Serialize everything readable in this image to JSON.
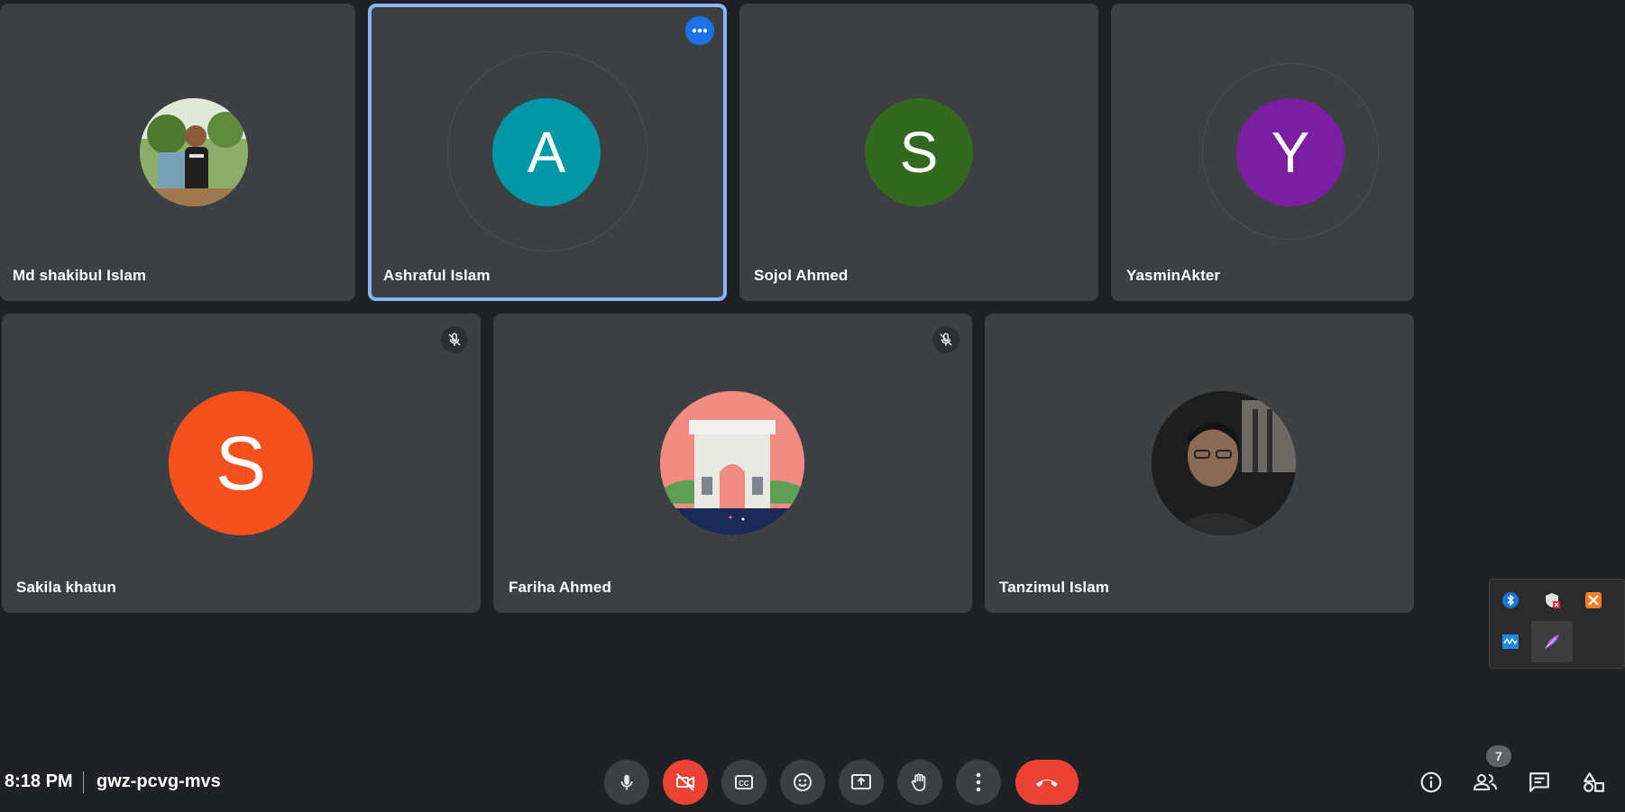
{
  "participants": [
    {
      "name": "Md shakibul Islam",
      "initial": "",
      "avatar_type": "photo",
      "color": "#6b8f4a"
    },
    {
      "name": "Ashraful Islam",
      "initial": "A",
      "avatar_type": "letter",
      "color": "#0097a7"
    },
    {
      "name": "Sojol Ahmed",
      "initial": "S",
      "avatar_type": "letter",
      "color": "#33691e"
    },
    {
      "name": "YasminAkter",
      "initial": "Y",
      "avatar_type": "letter",
      "color": "#7b1fa2"
    },
    {
      "name": "Sakila khatun",
      "initial": "S",
      "avatar_type": "letter",
      "color": "#f4511e",
      "muted": true
    },
    {
      "name": "Fariha Ahmed",
      "initial": "",
      "avatar_type": "illustration",
      "color": "#f28b82",
      "muted": true
    },
    {
      "name": "Tanzimul Islam",
      "initial": "",
      "avatar_type": "photo",
      "color": "#2a2a2a"
    }
  ],
  "meeting": {
    "time": "8:18 PM",
    "code": "gwz-pcvg-mvs",
    "participant_count": "7"
  },
  "controls": [
    {
      "id": "mic",
      "icon": "mic-icon",
      "state": "on"
    },
    {
      "id": "camera",
      "icon": "camera-off-icon",
      "state": "off"
    },
    {
      "id": "captions",
      "icon": "closed-captions-icon"
    },
    {
      "id": "reactions",
      "icon": "emoji-icon"
    },
    {
      "id": "present",
      "icon": "present-screen-icon"
    },
    {
      "id": "raise-hand",
      "icon": "hand-icon"
    },
    {
      "id": "more",
      "icon": "more-vertical-icon"
    },
    {
      "id": "leave",
      "icon": "call-end-icon"
    }
  ],
  "side_controls": [
    {
      "id": "info",
      "icon": "info-icon"
    },
    {
      "id": "people",
      "icon": "people-icon"
    },
    {
      "id": "chat",
      "icon": "chat-icon"
    },
    {
      "id": "activities",
      "icon": "activities-icon"
    }
  ],
  "tray_icons": [
    "bluetooth-icon",
    "security-shield-icon",
    "xampp-icon",
    "network-monitor-icon",
    "feather-app-icon"
  ],
  "colors": {
    "background": "#202124",
    "tile": "#3c4043",
    "active_border": "#8ab4f8",
    "danger": "#ea4335",
    "accent": "#1a73e8"
  }
}
